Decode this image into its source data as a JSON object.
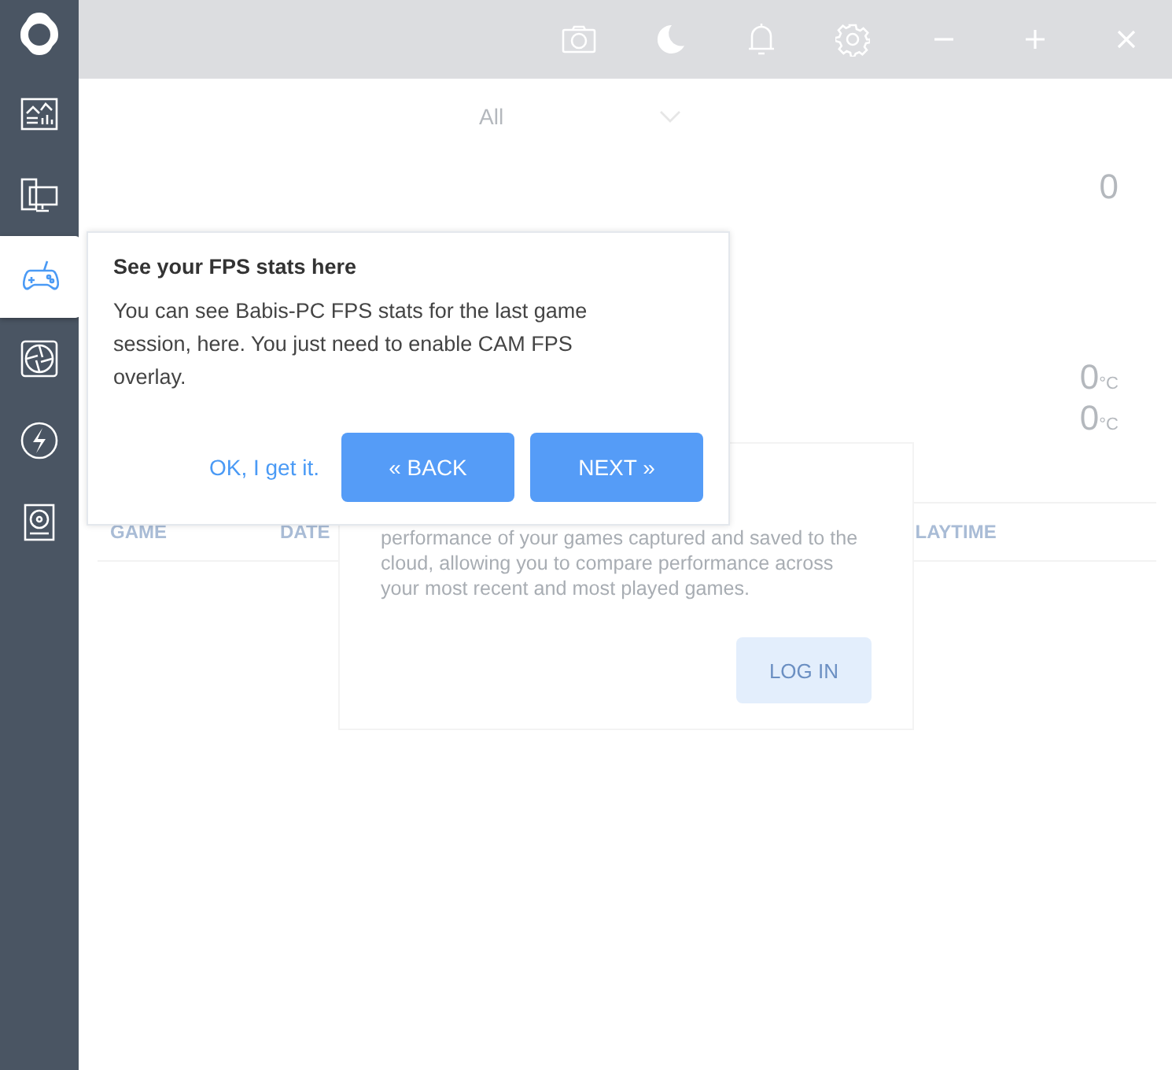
{
  "sidebar": {
    "items": [
      {
        "selected": false
      },
      {
        "selected": false
      },
      {
        "selected": true
      },
      {
        "selected": false
      },
      {
        "selected": false
      },
      {
        "selected": false
      }
    ]
  },
  "filter": {
    "value": "All"
  },
  "stats": [
    {
      "value": "0"
    },
    {
      "value": "0",
      "unit": "°C"
    },
    {
      "value": "0",
      "unit": "°C"
    }
  ],
  "table": {
    "columns": [
      "GAME",
      "DATE",
      "LAYTIME"
    ]
  },
  "login_card": {
    "text": "performance of your games captured and saved to the cloud, allowing you to compare performance across your most recent and most played games.",
    "button": "LOG IN"
  },
  "tooltip": {
    "title": "See your FPS stats here",
    "body": "You can see Babis-PC FPS stats for the last game session, here. You just need to enable CAM FPS overlay.",
    "dismiss": "OK, I get it.",
    "back": "« BACK",
    "next": "NEXT »"
  }
}
